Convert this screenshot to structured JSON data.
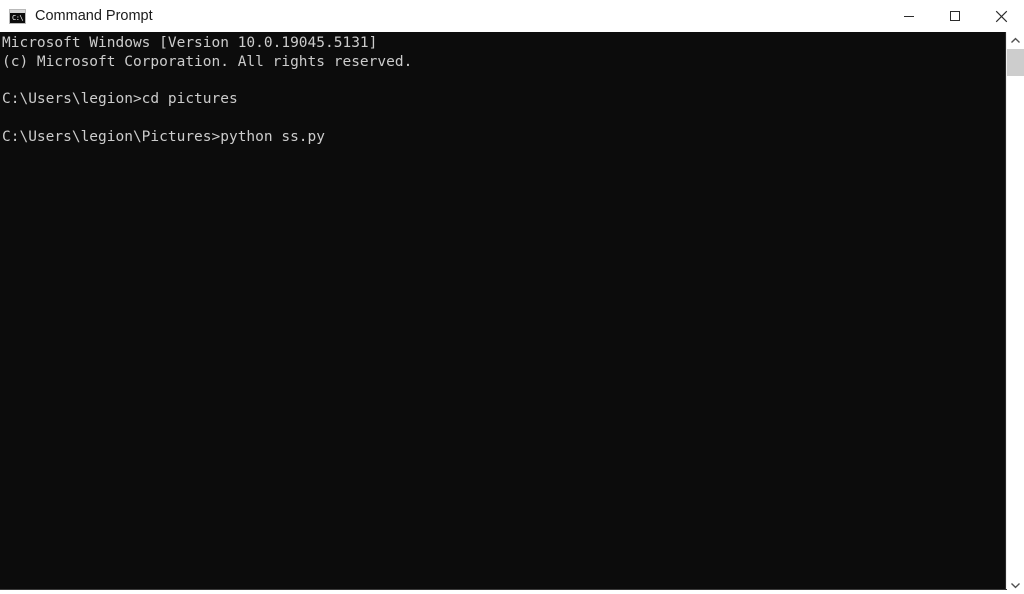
{
  "window": {
    "title": "Command Prompt",
    "icon": "console-icon",
    "icon_glyph": "C:\\",
    "titlebar_background": "#ffffff",
    "title_color": "#1b1b1b"
  },
  "window_controls": {
    "minimize": {
      "label": "Minimize",
      "icon": "minimize-icon"
    },
    "maximize": {
      "label": "Maximize",
      "icon": "maximize-icon"
    },
    "close": {
      "label": "Close",
      "icon": "close-icon"
    }
  },
  "console": {
    "background": "#0c0c0c",
    "foreground": "#cccccc",
    "lines": [
      "Microsoft Windows [Version 10.0.19045.5131]",
      "(c) Microsoft Corporation. All rights reserved.",
      "",
      "C:\\Users\\legion>cd pictures",
      "",
      "C:\\Users\\legion\\Pictures>python ss.py"
    ],
    "text": "Microsoft Windows [Version 10.0.19045.5131]\n(c) Microsoft Corporation. All rights reserved.\n\nC:\\Users\\legion>cd pictures\n\nC:\\Users\\legion\\Pictures>python ss.py",
    "prompts": [
      {
        "cwd": "C:\\Users\\legion",
        "command": "cd pictures"
      },
      {
        "cwd": "C:\\Users\\legion\\Pictures",
        "command": "python ss.py"
      }
    ]
  },
  "scrollbar": {
    "up_arrow": "chevron-up-icon",
    "down_arrow": "chevron-down-icon",
    "thumb_color": "#cdcdcd",
    "track_color": "#ffffff"
  }
}
